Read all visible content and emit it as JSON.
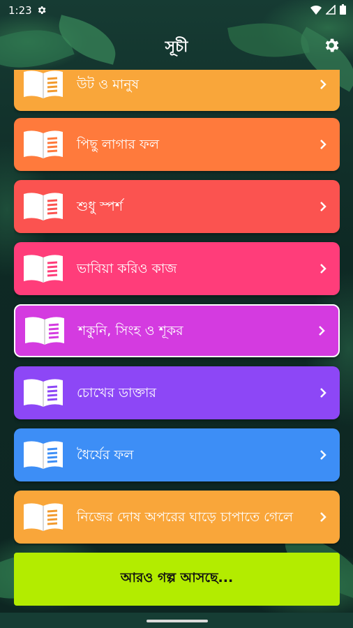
{
  "status_bar": {
    "time": "1:23"
  },
  "app_bar": {
    "title": "সূচী"
  },
  "colors": {
    "orange_light": "#f9a63a",
    "orange": "#ff7a3c",
    "red": "#fb5350",
    "pink": "#ff3d7a",
    "magenta": "#d43be0",
    "purple": "#8d47f6",
    "blue": "#3d8ef6",
    "orange_light_2": "#f9a63a",
    "more_button": "#b3ec00"
  },
  "stories": [
    {
      "label": "উট ও মানুষ",
      "color": "#f9a63a",
      "icon_line_color": "#f29a2f",
      "selected": false
    },
    {
      "label": "পিছু লাগার ফল",
      "color": "#ff7a3c",
      "icon_line_color": "#ff7a3c",
      "selected": false
    },
    {
      "label": "শুধু স্পর্শ",
      "color": "#fb5350",
      "icon_line_color": "#fb5350",
      "selected": false
    },
    {
      "label": "ভাবিয়া করিও কাজ",
      "color": "#ff3d7a",
      "icon_line_color": "#ff3d7a",
      "selected": false
    },
    {
      "label": "শকুনি, সিংহ ও শূকর",
      "color": "#d43be0",
      "icon_line_color": "#d43be0",
      "selected": true
    },
    {
      "label": "চোখের ডাক্তার",
      "color": "#8d47f6",
      "icon_line_color": "#8d47f6",
      "selected": false
    },
    {
      "label": "ধৈর্যের ফল",
      "color": "#3d8ef6",
      "icon_line_color": "#3d8ef6",
      "selected": false
    },
    {
      "label": "নিজের দোষ অপরের ঘাড়ে চাপাতে গেলে",
      "color": "#f9a63a",
      "icon_line_color": "#f29a2f",
      "selected": false
    }
  ],
  "more_button": {
    "label": "আরও গল্প আসছে..."
  }
}
